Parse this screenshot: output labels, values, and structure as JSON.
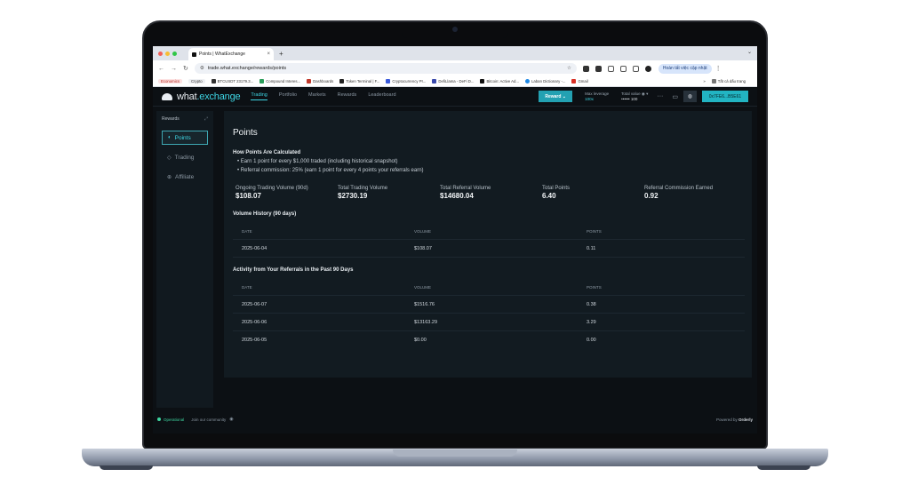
{
  "browser": {
    "tab_title": "Points | WhatExchange",
    "tab_close": "×",
    "new_tab": "+",
    "tab_chevron": "⌄",
    "url": "trade.what.exchange/rewards/points",
    "update_label": "Hoàn tất việc cập nhật",
    "menu_glyph": "⋮",
    "bookmarks": [
      "Economics",
      "Crypto",
      "BTCUSDT 23179.3...",
      "Compound Interes...",
      "Dashboards",
      "Token Terminal | F...",
      "Cryptocurrency Pr...",
      "DefiLlama - DeFi D...",
      "Bitcoin: Active Ad...",
      "Laban Dictionary -...",
      "Gmail"
    ],
    "bookmarks_more": "»",
    "all_bookmarks": "Tất cả dấu trang"
  },
  "app": {
    "logo_text_1": "what",
    "logo_text_2": ".exchange",
    "nav": [
      "Trading",
      "Portfolio",
      "Markets",
      "Rewards",
      "Leaderboard"
    ],
    "reward_button": "Reward ⌄",
    "max_leverage_label": "Max leverage",
    "max_leverage_value": "100x",
    "total_value_label": "Total value ◉ ▾",
    "total_value_value": "•••••• 100",
    "more_glyph": "···",
    "wallet_button": "0x7FE6...B5E61",
    "sidebar": {
      "title": "Rewards",
      "collapse_glyph": "⤢",
      "items": [
        {
          "label": "Points",
          "icon": "◐"
        },
        {
          "label": "Trading",
          "icon": "◇"
        },
        {
          "label": "Affiliate",
          "icon": "⊕"
        }
      ]
    },
    "page": {
      "title": "Points",
      "how_title": "How Points Are Calculated",
      "bullets": [
        "Earn 1 point for every $1,000 traded (including historical snapshot)",
        "Referral commission: 25% (earn 1 point for every 4 points your referrals earn)"
      ],
      "metrics": [
        {
          "label": "Ongoing Trading Volume (90d)",
          "value": "$108.07"
        },
        {
          "label": "Total Trading Volume",
          "value": "$2730.19"
        },
        {
          "label": "Total Referral Volume",
          "value": "$14680.04"
        },
        {
          "label": "Total Points",
          "value": "6.40"
        },
        {
          "label": "Referral Commission Earned",
          "value": "0.92"
        }
      ],
      "volume_history": {
        "title": "Volume History (90 days)",
        "headers": [
          "DATE",
          "VOLUME",
          "POINTS"
        ],
        "rows": [
          [
            "2025-06-04",
            "$108.07",
            "0.11"
          ]
        ]
      },
      "referral_activity": {
        "title": "Activity from Your Referrals in the Past 90 Days",
        "headers": [
          "DATE",
          "VOLUME",
          "POINTS"
        ],
        "rows": [
          [
            "2025-06-07",
            "$1516.76",
            "0.38"
          ],
          [
            "2025-06-06",
            "$13163.29",
            "3.29"
          ],
          [
            "2025-06-05",
            "$0.00",
            "0.00"
          ]
        ]
      }
    },
    "footer": {
      "status": "Operational",
      "community": "Join our community",
      "community_icon": "◉",
      "powered_prefix": "Powered by ",
      "powered_brand": "Orderly"
    }
  }
}
